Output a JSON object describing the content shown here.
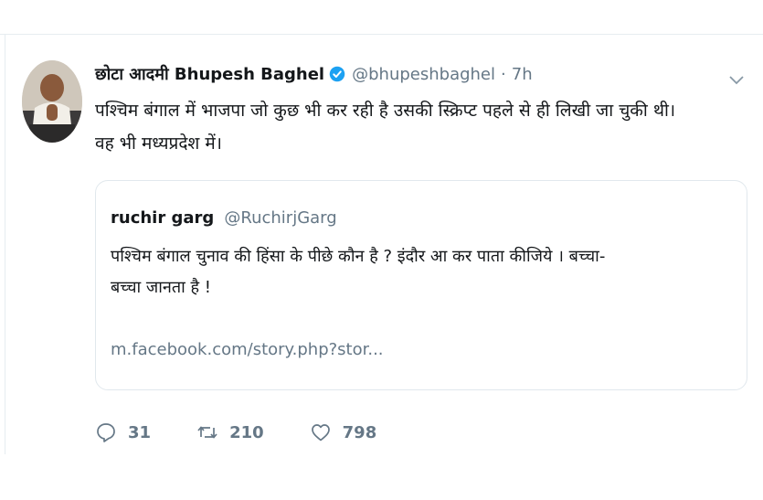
{
  "tweet": {
    "display_name": "छोटा आदमी Bhupesh Baghel",
    "handle": "@bhupeshbaghel",
    "separator": "·",
    "time": "7h",
    "text_line1": "पश्चिम बंगाल में भाजपा जो कुछ भी कर रही है उसकी स्क्रिप्ट पहले से ही लिखी जा चुकी थी।",
    "text_line2": "वह भी मध्यप्रदेश में।"
  },
  "quoted": {
    "name": "ruchir garg",
    "handle": "@RuchirjGarg",
    "text_line1": "पश्चिम बंगाल चुनाव की हिंसा के पीछे कौन है ? इंदौर आ कर पाता कीजिये । बच्चा-",
    "text_line2": "बच्चा जानता है !",
    "link": "m.facebook.com/story.php?stor..."
  },
  "actions": {
    "replies": "31",
    "retweets": "210",
    "likes": "798"
  },
  "colors": {
    "verified_blue": "#1da1f2",
    "muted_gray": "#657786",
    "border": "#e1e8ed"
  },
  "icons": [
    "verified-icon",
    "chevron-down-icon",
    "reply-icon",
    "retweet-icon",
    "like-icon"
  ]
}
